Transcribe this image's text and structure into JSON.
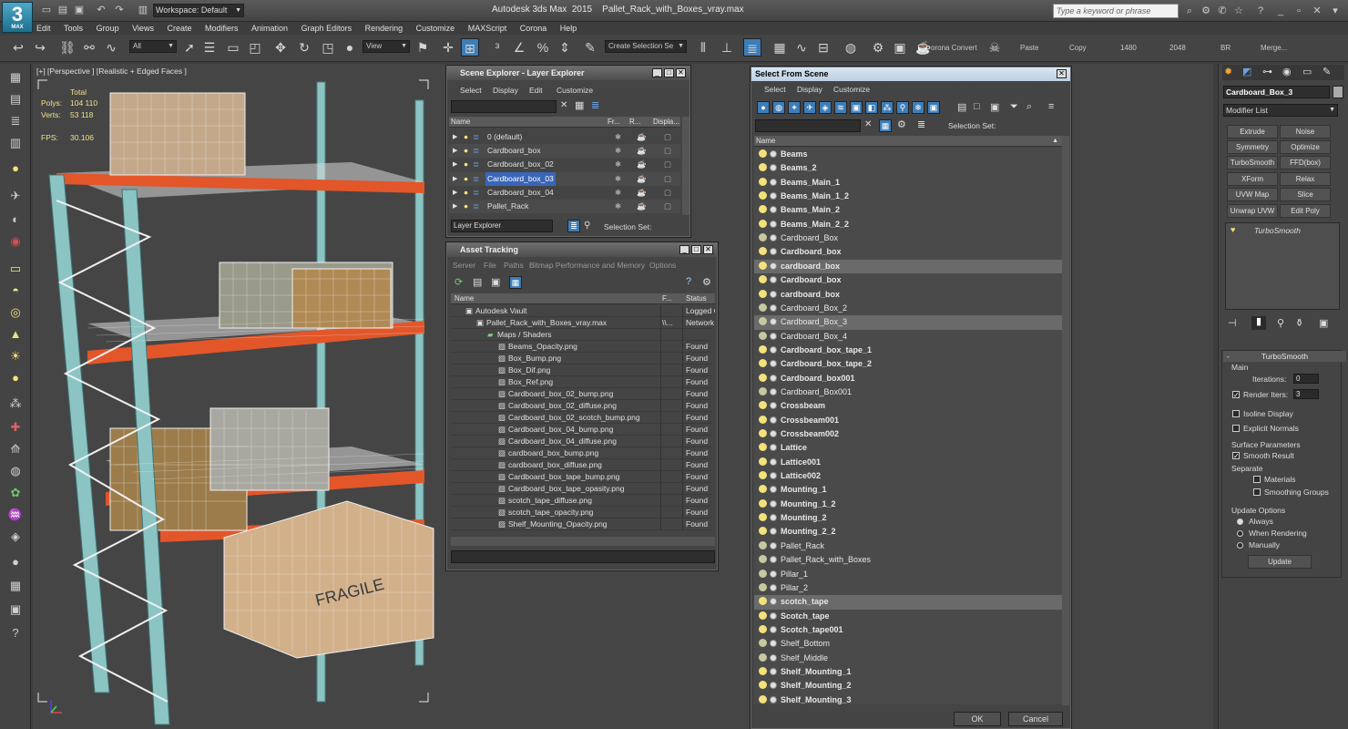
{
  "app": {
    "logo_text": "MAX",
    "title": "Autodesk 3ds Max  2015    Pallet_Rack_with_Boxes_vray.max",
    "workspace": "Workspace: Default",
    "keyword_search_placeholder": "Type a keyword or phrase"
  },
  "menus": [
    "Edit",
    "Tools",
    "Group",
    "Views",
    "Create",
    "Modifiers",
    "Animation",
    "Graph Editors",
    "Rendering",
    "Customize",
    "MAXScript",
    "Corona",
    "Help"
  ],
  "toolbar": {
    "selection_filter": "All",
    "reference_coord": "View",
    "named_selection_placeholder": "Create Selection Se",
    "corona_convert": "orona Convert",
    "paste": "Paste",
    "copy": "Copy",
    "res_w": "1480",
    "res_h": "2048",
    "br": "BR",
    "merge": "Merge..."
  },
  "viewport": {
    "label": "[+] [Perspective ] [Realistic + Edged Faces ]",
    "stats": {
      "total_label": "Total",
      "polys_label": "Polys:",
      "polys_value": "104 110",
      "verts_label": "Verts:",
      "verts_value": "53 118",
      "fps_label": "FPS:",
      "fps_value": "30.106"
    },
    "crate_label": "FRAGILE"
  },
  "scene_explorer": {
    "title": "Scene Explorer - Layer Explorer",
    "menus": [
      "Select",
      "Display",
      "Edit",
      "Customize"
    ],
    "columns": [
      "Name",
      "Fr...",
      "R...",
      "Displa..."
    ],
    "rows": [
      "0 (default)",
      "Cardboard_box",
      "Cardboard_box_02",
      "Cardboard_box_03",
      "Cardboard_box_04",
      "Pallet_Rack"
    ],
    "selected_index": 3,
    "footer_mode": "Layer Explorer",
    "footer_selection_set": "Selection Set:"
  },
  "asset_tracking": {
    "title": "Asset Tracking",
    "menus": [
      "Server",
      "File",
      "Paths",
      "Bitmap Performance and Memory",
      "Options"
    ],
    "columns": [
      "Name",
      "F...",
      "Status"
    ],
    "rows": [
      {
        "name": "Autodesk Vault",
        "path": "",
        "status": "Logged O",
        "indent": 1
      },
      {
        "name": "Pallet_Rack_with_Boxes_vray.max",
        "path": "\\\\...",
        "status": "Network",
        "indent": 2
      },
      {
        "name": "Maps / Shaders",
        "path": "",
        "status": "",
        "indent": 3
      },
      {
        "name": "Beams_Opacity.png",
        "path": "",
        "status": "Found",
        "indent": 4
      },
      {
        "name": "Box_Bump.png",
        "path": "",
        "status": "Found",
        "indent": 4
      },
      {
        "name": "Box_Dif.png",
        "path": "",
        "status": "Found",
        "indent": 4
      },
      {
        "name": "Box_Ref.png",
        "path": "",
        "status": "Found",
        "indent": 4
      },
      {
        "name": "Cardboard_box_02_bump.png",
        "path": "",
        "status": "Found",
        "indent": 4
      },
      {
        "name": "Cardboard_box_02_diffuse.png",
        "path": "",
        "status": "Found",
        "indent": 4
      },
      {
        "name": "Cardboard_box_02_scotch_bump.png",
        "path": "",
        "status": "Found",
        "indent": 4
      },
      {
        "name": "Cardboard_box_04_bump.png",
        "path": "",
        "status": "Found",
        "indent": 4
      },
      {
        "name": "Cardboard_box_04_diffuse.png",
        "path": "",
        "status": "Found",
        "indent": 4
      },
      {
        "name": "cardboard_box_bump.png",
        "path": "",
        "status": "Found",
        "indent": 4
      },
      {
        "name": "cardboard_box_diffuse.png",
        "path": "",
        "status": "Found",
        "indent": 4
      },
      {
        "name": "Cardboard_box_tape_bump.png",
        "path": "",
        "status": "Found",
        "indent": 4
      },
      {
        "name": "Cardboard_box_tape_opasity.png",
        "path": "",
        "status": "Found",
        "indent": 4
      },
      {
        "name": "scotch_tape_diffuse.png",
        "path": "",
        "status": "Found",
        "indent": 4
      },
      {
        "name": "scotch_tape_opacity.png",
        "path": "",
        "status": "Found",
        "indent": 4
      },
      {
        "name": "Shelf_Mounting_Opacity.png",
        "path": "",
        "status": "Found",
        "indent": 4
      }
    ]
  },
  "select_from_scene": {
    "title": "Select From Scene",
    "menus": [
      "Select",
      "Display",
      "Customize"
    ],
    "selection_set_label": "Selection Set:",
    "column": "Name",
    "ok": "OK",
    "cancel": "Cancel",
    "rows": [
      {
        "name": "Beams",
        "bold": true,
        "hl": false,
        "light": true
      },
      {
        "name": "Beams_2",
        "bold": true,
        "hl": false,
        "light": true
      },
      {
        "name": "Beams_Main_1",
        "bold": true,
        "hl": false,
        "light": true
      },
      {
        "name": "Beams_Main_1_2",
        "bold": true,
        "hl": false,
        "light": true
      },
      {
        "name": "Beams_Main_2",
        "bold": true,
        "hl": false,
        "light": true
      },
      {
        "name": "Beams_Main_2_2",
        "bold": true,
        "hl": false,
        "light": true
      },
      {
        "name": "Cardboard_Box",
        "bold": false,
        "hl": false,
        "light": false
      },
      {
        "name": "Cardboard_box",
        "bold": true,
        "hl": false,
        "light": true
      },
      {
        "name": "cardboard_box",
        "bold": true,
        "hl": true,
        "light": true
      },
      {
        "name": "Cardboard_box",
        "bold": true,
        "hl": false,
        "light": true
      },
      {
        "name": "cardboard_box",
        "bold": true,
        "hl": false,
        "light": true
      },
      {
        "name": "Cardboard_Box_2",
        "bold": false,
        "hl": false,
        "light": false
      },
      {
        "name": "Cardboard_Box_3",
        "bold": false,
        "hl": true,
        "light": false
      },
      {
        "name": "Cardboard_Box_4",
        "bold": false,
        "hl": false,
        "light": false
      },
      {
        "name": "Cardboard_box_tape_1",
        "bold": true,
        "hl": false,
        "light": true
      },
      {
        "name": "Cardboard_box_tape_2",
        "bold": true,
        "hl": false,
        "light": true
      },
      {
        "name": "Cardboard_box001",
        "bold": true,
        "hl": false,
        "light": true
      },
      {
        "name": "Cardboard_Box001",
        "bold": false,
        "hl": false,
        "light": false
      },
      {
        "name": "Crossbeam",
        "bold": true,
        "hl": false,
        "light": true
      },
      {
        "name": "Crossbeam001",
        "bold": true,
        "hl": false,
        "light": true
      },
      {
        "name": "Crossbeam002",
        "bold": true,
        "hl": false,
        "light": true
      },
      {
        "name": "Lattice",
        "bold": true,
        "hl": false,
        "light": true
      },
      {
        "name": "Lattice001",
        "bold": true,
        "hl": false,
        "light": true
      },
      {
        "name": "Lattice002",
        "bold": true,
        "hl": false,
        "light": true
      },
      {
        "name": "Mounting_1",
        "bold": true,
        "hl": false,
        "light": true
      },
      {
        "name": "Mounting_1_2",
        "bold": true,
        "hl": false,
        "light": true
      },
      {
        "name": "Mounting_2",
        "bold": true,
        "hl": false,
        "light": true
      },
      {
        "name": "Mounting_2_2",
        "bold": true,
        "hl": false,
        "light": true
      },
      {
        "name": "Pallet_Rack",
        "bold": false,
        "hl": false,
        "light": false
      },
      {
        "name": "Pallet_Rack_with_Boxes",
        "bold": false,
        "hl": false,
        "light": false
      },
      {
        "name": "Pillar_1",
        "bold": false,
        "hl": false,
        "light": false
      },
      {
        "name": "Pillar_2",
        "bold": false,
        "hl": false,
        "light": false
      },
      {
        "name": "scotch_tape",
        "bold": true,
        "hl": true,
        "light": true
      },
      {
        "name": "Scotch_tape",
        "bold": true,
        "hl": false,
        "light": true
      },
      {
        "name": "Scotch_tape001",
        "bold": true,
        "hl": false,
        "light": true
      },
      {
        "name": "Shelf_Bottom",
        "bold": false,
        "hl": false,
        "light": false
      },
      {
        "name": "Shelf_Middle",
        "bold": false,
        "hl": false,
        "light": false
      },
      {
        "name": "Shelf_Mounting_1",
        "bold": true,
        "hl": false,
        "light": true
      },
      {
        "name": "Shelf_Mounting_2",
        "bold": true,
        "hl": false,
        "light": true
      },
      {
        "name": "Shelf_Mounting_3",
        "bold": true,
        "hl": false,
        "light": true
      }
    ]
  },
  "command_panel": {
    "object_name": "Cardboard_Box_3",
    "modifier_list": "Modifier List",
    "modifier_buttons": [
      "Extrude",
      "Noise",
      "Symmetry",
      "Optimize",
      "TurboSmooth",
      "FFD(box)",
      "XForm",
      "Relax",
      "UVW Map",
      "Slice",
      "Unwrap UVW",
      "Edit Poly"
    ],
    "stack_item": "TurboSmooth",
    "rollout_title": "TurboSmooth",
    "main_label": "Main",
    "iterations_label": "Iterations:",
    "iterations_value": "0",
    "render_iters_label": "Render Iters:",
    "render_iters_value": "3",
    "isoline_label": "Isoline Display",
    "explicit_normals_label": "Explicit Normals",
    "surface_params_label": "Surface Parameters",
    "smooth_result_label": "Smooth Result",
    "separate_label": "Separate",
    "materials_label": "Materials",
    "smoothing_groups_label": "Smoothing Groups",
    "update_options_label": "Update Options",
    "always_label": "Always",
    "when_rendering_label": "When Rendering",
    "manually_label": "Manually",
    "update_button": "Update"
  },
  "colors": {
    "accent_blue": "#3a66b8",
    "rack_orange": "#e2562a",
    "rack_teal": "#6fb8b8",
    "stat_yellow": "#f0e28a"
  }
}
